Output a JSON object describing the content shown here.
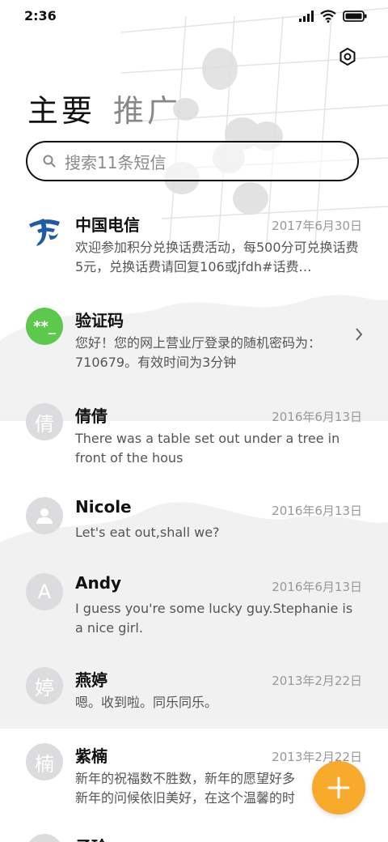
{
  "status_bar": {
    "time": "2:36"
  },
  "tabs": [
    {
      "label": "主要",
      "active": true
    },
    {
      "label": "推广",
      "active": false
    }
  ],
  "search": {
    "placeholder": "搜索11条短信"
  },
  "conversations": [
    {
      "name": "中国电信",
      "date": "2017年6月30日",
      "preview": "欢迎参加积分兑换话费活动，每500分可兑换话费5元，兑换话费请回复106或jfdh#话费…",
      "avatar": "telecom-logo",
      "avatar_text": ""
    },
    {
      "name": "验证码",
      "date": "",
      "preview": "您好！您的网上营业厅登录的随机密码为：710679。有效时间为3分钟",
      "avatar": "verification",
      "avatar_text": "**_"
    },
    {
      "name": "倩倩",
      "date": "2016年6月13日",
      "preview": "There was a table set out under a tree in front of the hous",
      "avatar": "letter",
      "avatar_text": "倩"
    },
    {
      "name": "Nicole",
      "date": "2016年6月13日",
      "preview": "Let's eat out,shall we?",
      "avatar": "person-icon",
      "avatar_text": ""
    },
    {
      "name": "Andy",
      "date": "2016年6月13日",
      "preview": "I guess you're some lucky guy.Stephanie is a nice girl.",
      "avatar": "letter",
      "avatar_text": "A"
    },
    {
      "name": "燕婷",
      "date": "2013年2月22日",
      "preview": "嗯。收到啦。同乐同乐。",
      "avatar": "letter",
      "avatar_text": "婷"
    },
    {
      "name": "紫楠",
      "date": "2013年2月22日",
      "preview": "新年的祝福数不胜数，新年的愿望好多好多，新年的问候依旧美好，在这个温馨的时刻",
      "avatar": "letter",
      "avatar_text": "楠"
    },
    {
      "name": "子玲",
      "date": "",
      "preview": "",
      "avatar": "letter",
      "avatar_text": ""
    }
  ],
  "colors": {
    "accent": "#f7aa2c",
    "verification_green": "#5cc94c",
    "telecom_blue": "#1f5ca8"
  }
}
